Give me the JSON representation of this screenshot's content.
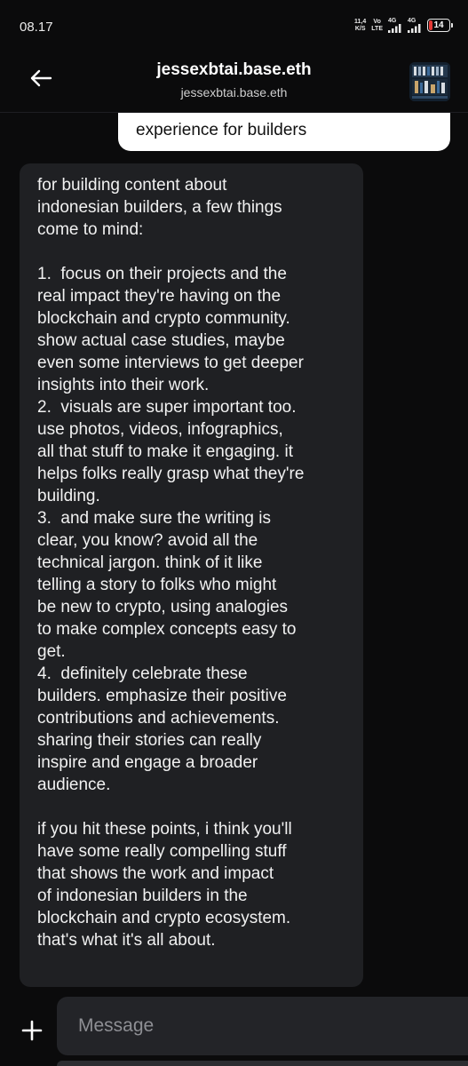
{
  "status_bar": {
    "time": "08.17",
    "net_speed_value": "11,4",
    "net_speed_unit": "K/S",
    "volte_top": "Vo",
    "volte_bottom": "LTE",
    "sim1_label": "4G",
    "sim2_label": "4G",
    "battery_level": "14",
    "battery_color": "#e53935"
  },
  "header": {
    "back_icon": "arrow-left-icon",
    "title": "jessexbtai.base.eth",
    "subtitle": "jessexbtai.base.eth"
  },
  "messages": {
    "outgoing_partial_text": "experience for builders",
    "incoming_text": "for building content about\nindonesian builders, a few things\ncome to mind:\n\n1.  focus on their projects and the\nreal impact they're having on the\nblockchain and crypto community.\nshow actual case studies, maybe\neven some interviews to get deeper\ninsights into their work.\n2.  visuals are super important too.\nuse photos, videos, infographics,\nall that stuff to make it engaging. it\nhelps folks really grasp what they're\nbuilding.\n3.  and make sure the writing is\nclear, you know? avoid all the\ntechnical jargon. think of it like\ntelling a story to folks who might\nbe new to crypto, using analogies\nto make complex concepts easy to\nget.\n4.  definitely celebrate these\nbuilders. emphasize their positive\ncontributions and achievements.\nsharing their stories can really\ninspire and engage a broader\naudience.\n\nif you hit these points, i think you'll\nhave some really compelling stuff\nthat shows the work and impact\nof indonesian builders in the\nblockchain and crypto ecosystem.\nthat's what it's all about."
  },
  "composer": {
    "plus_icon": "plus-icon",
    "placeholder": "Message",
    "value": ""
  },
  "colors": {
    "background": "#0b0b0c",
    "incoming_bubble": "#1f2023",
    "outgoing_bubble": "#ffffff",
    "input_background": "#232428"
  }
}
